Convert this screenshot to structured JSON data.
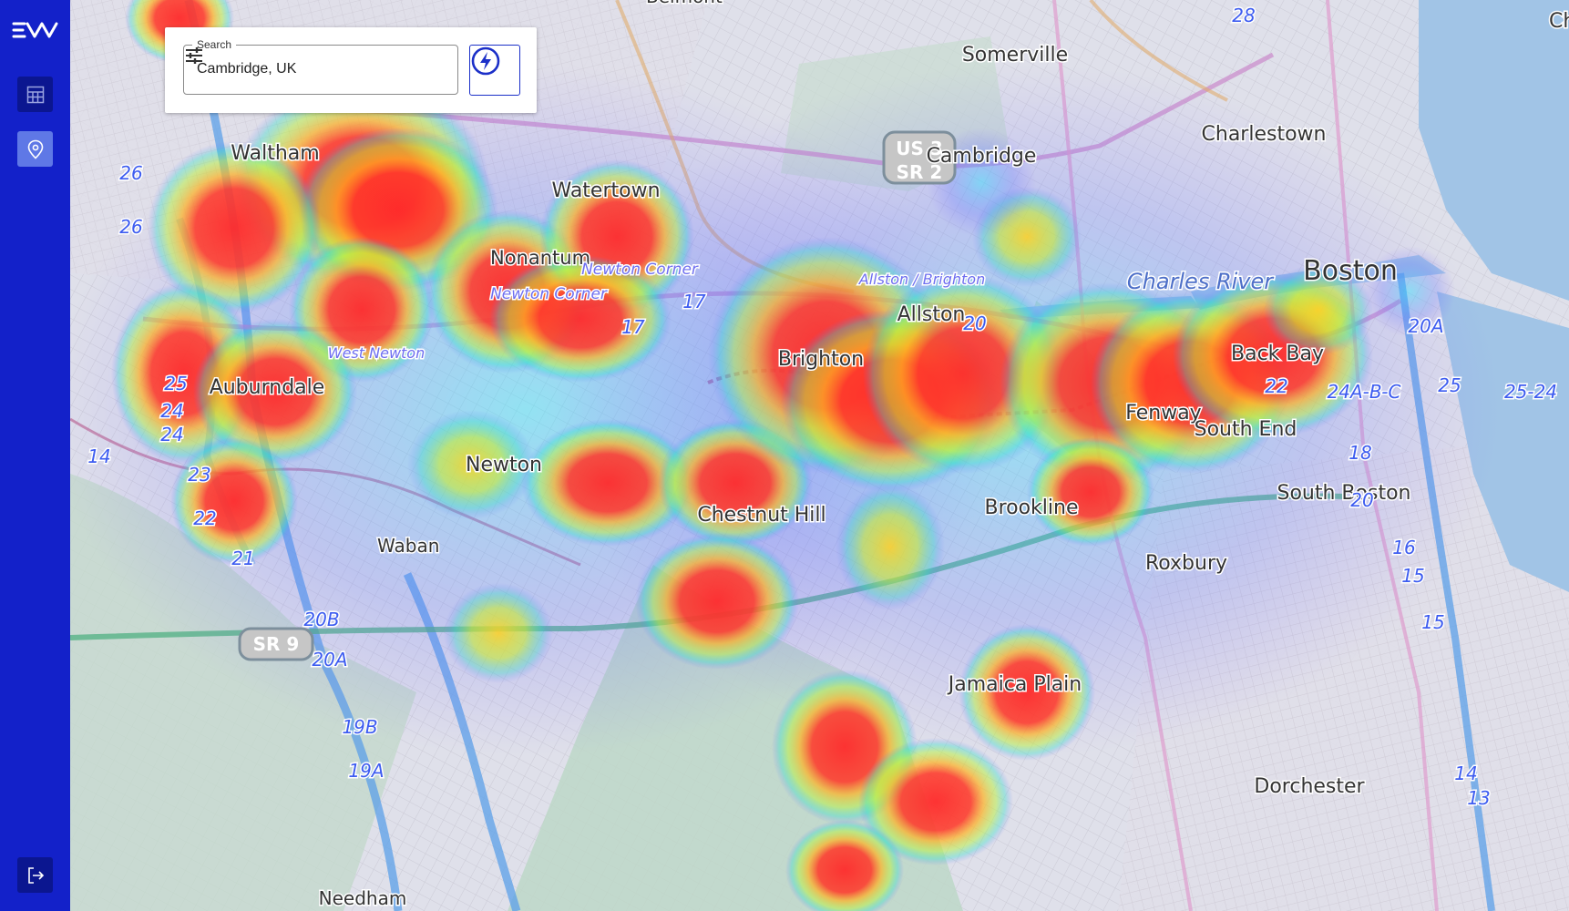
{
  "app": {
    "logo_alt": "EVA"
  },
  "sidebar": {
    "items": [
      {
        "icon": "table-grid-icon",
        "active": false
      },
      {
        "icon": "location-pin-icon",
        "active": true
      }
    ],
    "logout_icon": "logout-icon"
  },
  "search": {
    "label": "Search",
    "value": "Cambridge, UK",
    "filter_icon": "sliders-icon",
    "action_icon": "lightning-bolt-icon"
  },
  "map": {
    "type": "heatmap",
    "places": [
      {
        "name": "Somerville"
      },
      {
        "name": "Charlestown"
      },
      {
        "name": "Cambridge"
      },
      {
        "name": "Waltham"
      },
      {
        "name": "Watertown"
      },
      {
        "name": "Nonantum"
      },
      {
        "name": "Newton Corner"
      },
      {
        "name": "Newton Corner"
      },
      {
        "name": "Allston / Brighton"
      },
      {
        "name": "Allston"
      },
      {
        "name": "Charles River"
      },
      {
        "name": "Boston"
      },
      {
        "name": "Back Bay"
      },
      {
        "name": "Brighton"
      },
      {
        "name": "West Newton"
      },
      {
        "name": "Auburndale"
      },
      {
        "name": "Fenway"
      },
      {
        "name": "South End"
      },
      {
        "name": "Newton"
      },
      {
        "name": "Chestnut Hill"
      },
      {
        "name": "Brookline"
      },
      {
        "name": "Waban"
      },
      {
        "name": "South Boston"
      },
      {
        "name": "Roxbury"
      },
      {
        "name": "Jamaica Plain"
      },
      {
        "name": "Dorchester"
      },
      {
        "name": "Needham"
      },
      {
        "name": "Chels"
      },
      {
        "name": "Belmont"
      }
    ],
    "shields": [
      {
        "text": "US 3\nSR 2"
      },
      {
        "text": "SR 9"
      }
    ],
    "exit_numbers": [
      "28",
      "26",
      "26",
      "25",
      "24",
      "24",
      "14",
      "23",
      "22",
      "21",
      "20B",
      "20A",
      "19B",
      "19A",
      "17",
      "17",
      "20",
      "20A",
      "24A-B-C",
      "25",
      "25-24",
      "18",
      "20",
      "16",
      "15",
      "15",
      "14",
      "13",
      "22"
    ],
    "controls": {
      "pegman_icon": "pegman-icon",
      "zoom_in": "+",
      "zoom_out": "−"
    }
  }
}
